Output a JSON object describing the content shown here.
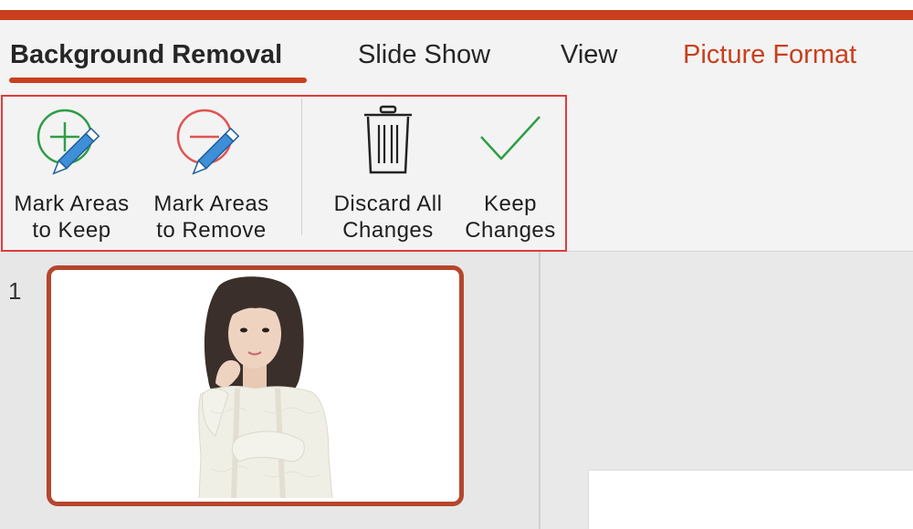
{
  "tabs": {
    "background_removal": "Background Removal",
    "slide_show": "Slide Show",
    "view": "View",
    "picture_format": "Picture Format"
  },
  "ribbon": {
    "mark_keep": "Mark Areas\nto Keep",
    "mark_remove": "Mark Areas\nto Remove",
    "discard_all": "Discard All\nChanges",
    "keep_changes": "Keep\nChanges"
  },
  "thumbnails": {
    "slide_number": "1"
  },
  "colors": {
    "accent": "#c8401f",
    "highlight_box": "#e03a3e",
    "keep_green": "#2e9e46",
    "remove_red": "#e05353",
    "pencil_blue": "#3f8ed8"
  },
  "icons": {
    "mark_keep": "plus-circle-pencil-icon",
    "mark_remove": "minus-circle-pencil-icon",
    "discard_all": "trash-can-icon",
    "keep_changes": "checkmark-icon"
  }
}
